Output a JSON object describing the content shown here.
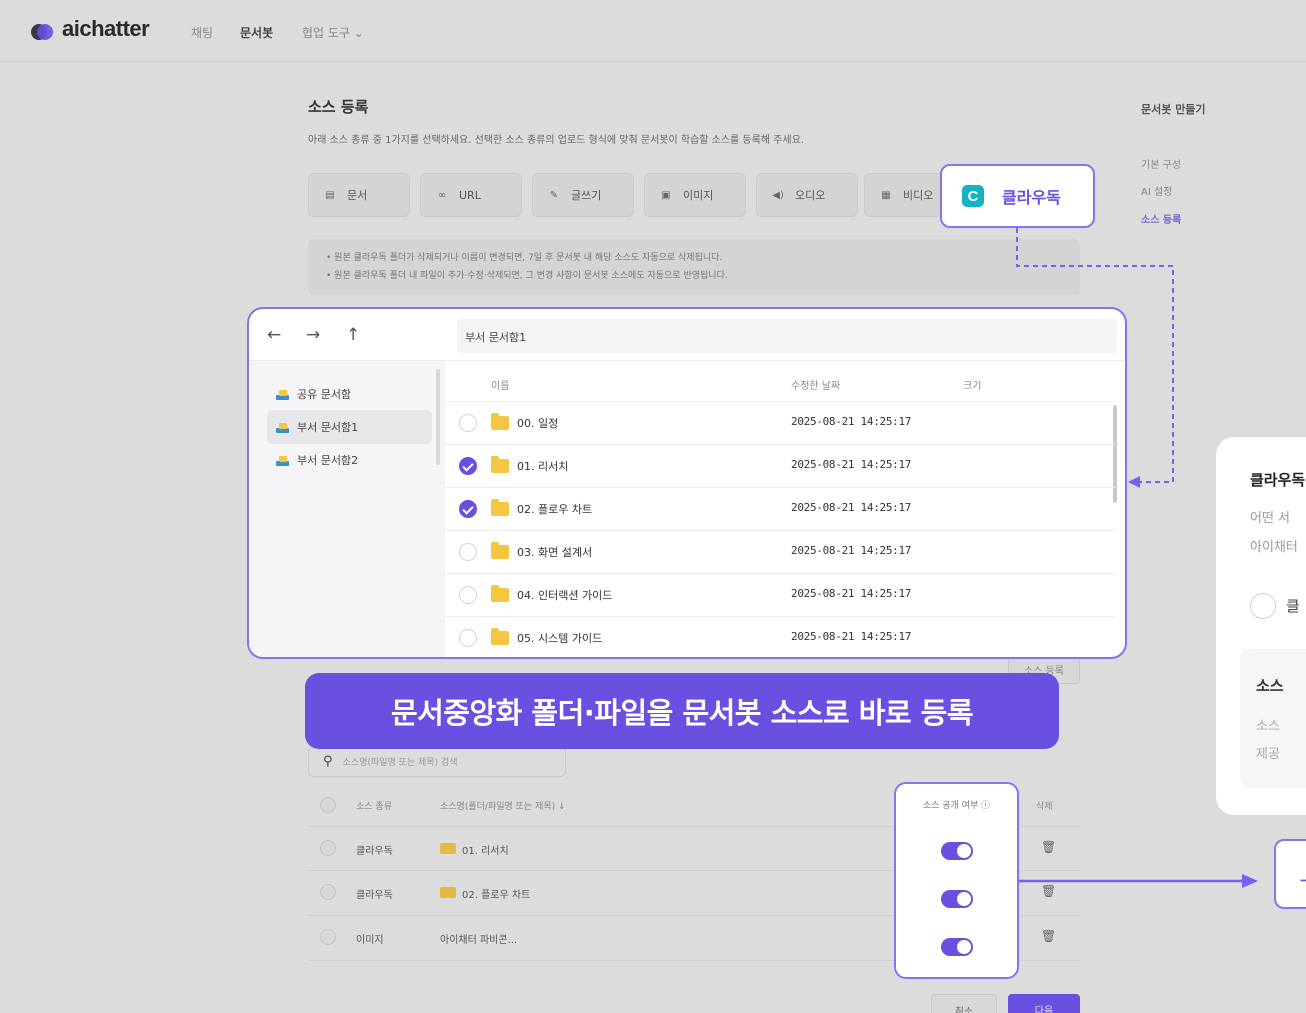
{
  "nav": {
    "brand": "aichatter",
    "items": [
      {
        "label": "채팅"
      },
      {
        "label": "문서봇"
      },
      {
        "label": "협업 도구 ⌄"
      }
    ]
  },
  "page": {
    "title": "소스 등록",
    "description": "아래 소스 종류 중 1가지를 선택하세요. 선택한 소스 종류의 업로드 형식에 맞춰 문서봇이 학습할 소스를 등록해 주세요.",
    "source_types": [
      {
        "label": "문서",
        "icon": "document-icon"
      },
      {
        "label": "URL",
        "icon": "link-icon"
      },
      {
        "label": "글쓰기",
        "icon": "write-icon"
      },
      {
        "label": "이미지",
        "icon": "image-icon"
      },
      {
        "label": "오디오",
        "icon": "audio-icon"
      },
      {
        "label": "비디오",
        "icon": "video-icon"
      }
    ],
    "notice": [
      "원본 클라우독 폴더가 삭제되거나 이름이 변경되면, 7일 후 문서봇 내 해당 소스도 자동으로 삭제됩니다.",
      "원본 클라우독 폴더 내 파일이 추가·수정·삭제되면, 그 변경 사항이 문서봇 소스에도 자동으로 반영됩니다."
    ],
    "register_button": "소스 등록"
  },
  "sidebar": {
    "title": "문서봇 만들기",
    "items": [
      {
        "label": "기본 구성"
      },
      {
        "label": "AI 설정"
      },
      {
        "label": "소스 등록"
      }
    ]
  },
  "cloudoc": {
    "logo_letter": "C",
    "label": "클라우독"
  },
  "explorer": {
    "path": "부서 문서함1",
    "sidebar": [
      {
        "label": "공유 문서함"
      },
      {
        "label": "부서 문서함1"
      },
      {
        "label": "부서 문서함2"
      }
    ],
    "columns": [
      "이름",
      "수정한 날짜",
      "크기"
    ],
    "rows": [
      {
        "name": "00. 일정",
        "date": "2025-08-21 14:25:17",
        "checked": false
      },
      {
        "name": "01. 리서치",
        "date": "2025-08-21 14:25:17",
        "checked": true
      },
      {
        "name": "02. 플로우 차트",
        "date": "2025-08-21 14:25:17",
        "checked": true
      },
      {
        "name": "03. 화면 설계서",
        "date": "2025-08-21 14:25:17",
        "checked": false
      },
      {
        "name": "04. 인터랙션 가이드",
        "date": "2025-08-21 14:25:17",
        "checked": false
      },
      {
        "name": "05. 시스템 가이드",
        "date": "2025-08-21 14:25:17",
        "checked": false
      }
    ]
  },
  "banner": "문서중앙화 폴더·파일을 문서봇 소스로 바로 등록",
  "sources": {
    "search_placeholder": "소스명(파일명 또는 제목) 검색",
    "headers": {
      "type": "소스 종류",
      "name": "소스명(폴더/파일명 또는 제목) ↓",
      "public": "소스 공개 여부 ⓘ",
      "delete": "삭제"
    },
    "rows": [
      {
        "type": "클라우독",
        "name": "01. 리서치",
        "folder": true,
        "public": true
      },
      {
        "type": "클라우독",
        "name": "02. 플로우 차트",
        "folder": true,
        "public": true
      },
      {
        "type": "이미지",
        "name": "아이채터 파비콘...",
        "folder": false,
        "public": true
      }
    ],
    "cancel": "취소",
    "next": "다음"
  },
  "dialog": {
    "title": "클라우독",
    "sub1": "어떤 서",
    "sub2": "아이채터",
    "radio_label": "클",
    "box_title": "소스",
    "box_text1": "소스",
    "box_text2": "제공"
  },
  "colors": {
    "accent": "#6b4fe0",
    "cloudoc": "#13b3c4",
    "folder": "#f5c640"
  }
}
